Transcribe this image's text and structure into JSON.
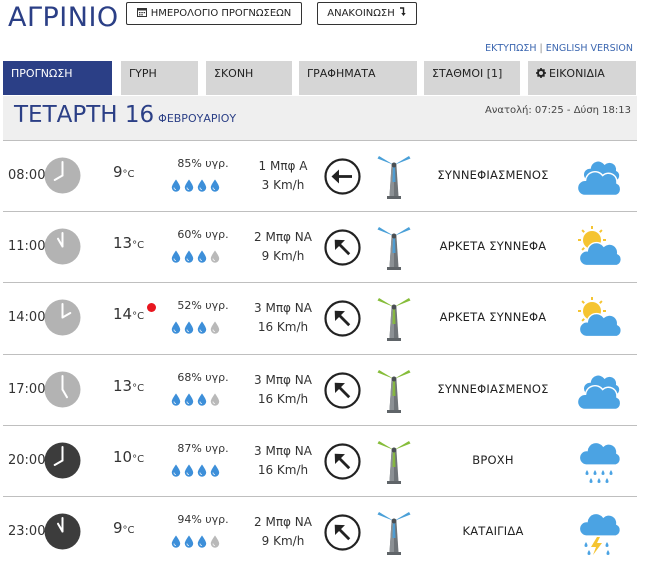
{
  "header": {
    "city": "ΑΓΡΙΝΙΟ",
    "calendar_button": "ΗΜΕΡΟΛΟΓΙΟ ΠΡΟΓΝΩΣΕΩΝ",
    "announce_button": "ΑΝΑΚΟΙΝΩΣΗ",
    "print_link": "ΕΚΤΥΠΩΣΗ",
    "english_link": "ENGLISH VERSION",
    "link_separator": "|"
  },
  "tabs": [
    {
      "label": "ΠΡΟΓΝΩΣΗ",
      "active": true
    },
    {
      "label": "ΓΥΡΗ",
      "active": false
    },
    {
      "label": "ΣΚΟΝΗ",
      "active": false
    },
    {
      "label": "ΓΡΑΦΗΜΑΤΑ",
      "active": false
    },
    {
      "label": "ΣΤΑΘΜΟΙ [1]",
      "active": false
    },
    {
      "label": "ΕΙΚΟΝΙΔΙΑ",
      "active": false,
      "icon": "gear-icon"
    }
  ],
  "day": {
    "name": "ΤΕΤΑΡΤΗ 16",
    "month": "ΦΕΒΡΟΥΑΡΙΟΥ",
    "sun": "Ανατολή: 07:25  - Δύση 18:13"
  },
  "colors": {
    "accent": "#2b3f86",
    "tab_inactive": "#d6d6d6",
    "drop_blue": "#3d8fd9",
    "drop_gray": "#b9b9b9",
    "clock_day": "#b3b3b3",
    "clock_night": "#3c3c3c",
    "turbine_blue": "#4aa0d8",
    "turbine_green": "#86bd3a",
    "sun_yellow": "#f5c431",
    "cloud_blue": "#4ba3e3",
    "red_dot": "#e8161f"
  },
  "rows": [
    {
      "time": "08:00",
      "hour": 8,
      "night": false,
      "temp": "9",
      "unit": "°C",
      "red_dot": false,
      "humidity": "85% υγρ.",
      "drops": 4,
      "wind_bft": "1 Μπφ Α",
      "wind_kmh": "3 Km/h",
      "wind_dir": "Α",
      "turbine": "blue",
      "condition": "ΣΥΝΝΕΦΙΑΣΜΕΝΟΣ",
      "icon": "clouds-icon"
    },
    {
      "time": "11:00",
      "hour": 11,
      "night": false,
      "temp": "13",
      "unit": "°C",
      "red_dot": false,
      "humidity": "60% υγρ.",
      "drops": 3,
      "wind_bft": "2 Μπφ ΝΑ",
      "wind_kmh": "9 Km/h",
      "wind_dir": "ΝΑ",
      "turbine": "blue",
      "condition": "ΑΡΚΕΤΑ ΣΥΝΝΕΦΑ",
      "icon": "sun-cloud-icon"
    },
    {
      "time": "14:00",
      "hour": 14,
      "night": false,
      "temp": "14",
      "unit": "°C",
      "red_dot": true,
      "humidity": "52% υγρ.",
      "drops": 3,
      "wind_bft": "3 Μπφ ΝΑ",
      "wind_kmh": "16 Km/h",
      "wind_dir": "ΝΑ",
      "turbine": "green",
      "condition": "ΑΡΚΕΤΑ ΣΥΝΝΕΦΑ",
      "icon": "sun-cloud-icon"
    },
    {
      "time": "17:00",
      "hour": 17,
      "night": false,
      "temp": "13",
      "unit": "°C",
      "red_dot": false,
      "humidity": "68% υγρ.",
      "drops": 3,
      "wind_bft": "3 Μπφ ΝΑ",
      "wind_kmh": "16 Km/h",
      "wind_dir": "ΝΑ",
      "turbine": "green",
      "condition": "ΣΥΝΝΕΦΙΑΣΜΕΝΟΣ",
      "icon": "clouds-icon"
    },
    {
      "time": "20:00",
      "hour": 20,
      "night": true,
      "temp": "10",
      "unit": "°C",
      "red_dot": false,
      "humidity": "87% υγρ.",
      "drops": 4,
      "wind_bft": "3 Μπφ ΝΑ",
      "wind_kmh": "16 Km/h",
      "wind_dir": "ΝΑ",
      "turbine": "green",
      "condition": "ΒΡΟΧΗ",
      "icon": "rain-icon"
    },
    {
      "time": "23:00",
      "hour": 23,
      "night": true,
      "temp": "9",
      "unit": "°C",
      "red_dot": false,
      "humidity": "94% υγρ.",
      "drops": 3,
      "wind_bft": "2 Μπφ ΝΑ",
      "wind_kmh": "9 Km/h",
      "wind_dir": "ΝΑ",
      "turbine": "blue",
      "condition": "ΚΑΤΑΙΓΙΔΑ",
      "icon": "storm-icon"
    }
  ]
}
